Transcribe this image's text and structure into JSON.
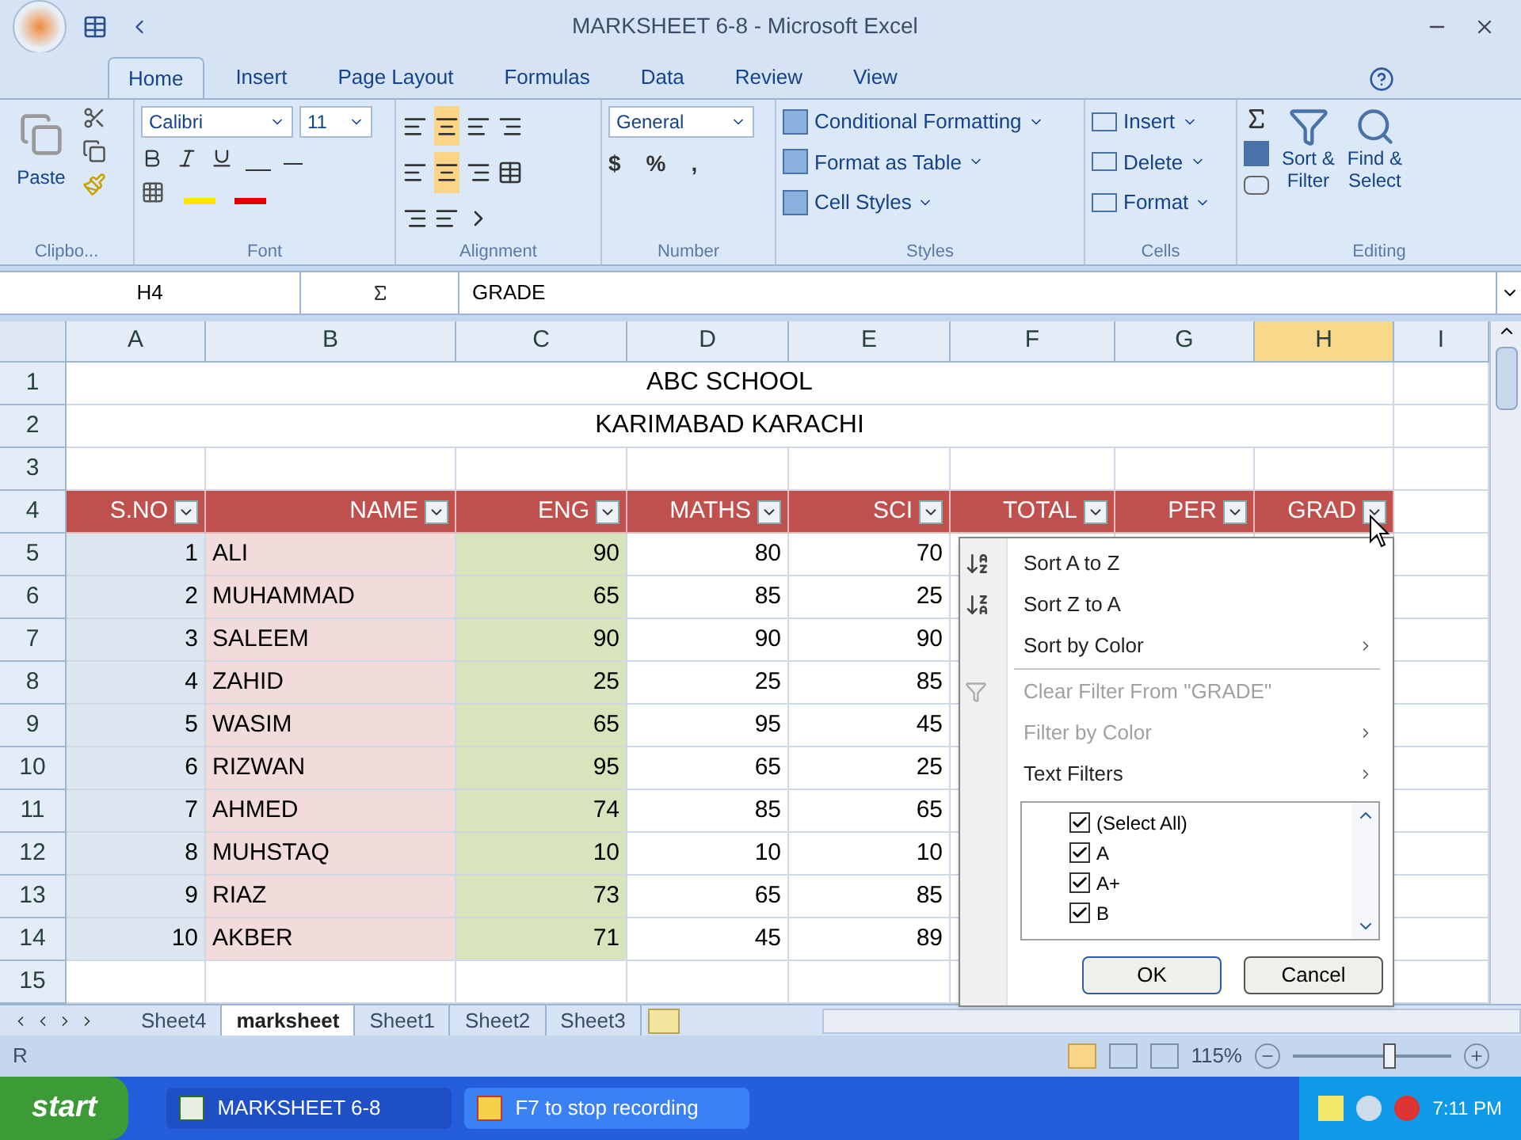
{
  "window": {
    "title": "MARKSHEET 6-8 - Microsoft Excel"
  },
  "ribbon_tabs": [
    {
      "label": "Home",
      "selected": true
    },
    {
      "label": "Insert",
      "selected": false
    },
    {
      "label": "Page Layout",
      "selected": false
    },
    {
      "label": "Formulas",
      "selected": false
    },
    {
      "label": "Data",
      "selected": false
    },
    {
      "label": "Review",
      "selected": false
    },
    {
      "label": "View",
      "selected": false
    }
  ],
  "ribbon": {
    "clipboard": {
      "paste": "Paste",
      "label": "Clipbo..."
    },
    "font": {
      "name": "Calibri",
      "size": "11",
      "label": "Font"
    },
    "alignment": {
      "label": "Alignment"
    },
    "number": {
      "format": "General",
      "currency": "$",
      "percent": "%",
      "comma": ",",
      "label": "Number"
    },
    "styles": {
      "items": [
        "Conditional Formatting",
        "Format as Table",
        "Cell Styles"
      ],
      "label": "Styles"
    },
    "cells": {
      "items": [
        "Insert",
        "Delete",
        "Format"
      ],
      "label": "Cells"
    },
    "editing": {
      "sort": [
        "Sort &",
        "Filter"
      ],
      "find": [
        "Find &",
        "Select"
      ],
      "label": "Editing"
    }
  },
  "formula_bar": {
    "name_box": "H4",
    "formula": "GRADE"
  },
  "columns": [
    {
      "label": "A",
      "selected": false
    },
    {
      "label": "B",
      "selected": false
    },
    {
      "label": "C",
      "selected": false
    },
    {
      "label": "D",
      "selected": false
    },
    {
      "label": "E",
      "selected": false
    },
    {
      "label": "F",
      "selected": false
    },
    {
      "label": "G",
      "selected": false
    },
    {
      "label": "H",
      "selected": true
    },
    {
      "label": "I",
      "selected": false
    }
  ],
  "title_rows": [
    {
      "row": "1",
      "text": "ABC SCHOOL"
    },
    {
      "row": "2",
      "text": "KARIMABAD KARACHI"
    }
  ],
  "blank_row_before": {
    "row": "3"
  },
  "header_row": {
    "row": "4",
    "headers": [
      "S.NO",
      "NAME",
      "ENG",
      "MATHS",
      "SCI",
      "TOTAL",
      "PER",
      "GRAD"
    ]
  },
  "data_rows": [
    {
      "row": "5",
      "sno": "1",
      "name": "ALI",
      "eng": "90",
      "maths": "80",
      "sci": "70"
    },
    {
      "row": "6",
      "sno": "2",
      "name": "MUHAMMAD",
      "eng": "65",
      "maths": "85",
      "sci": "25"
    },
    {
      "row": "7",
      "sno": "3",
      "name": "SALEEM",
      "eng": "90",
      "maths": "90",
      "sci": "90"
    },
    {
      "row": "8",
      "sno": "4",
      "name": "ZAHID",
      "eng": "25",
      "maths": "25",
      "sci": "85"
    },
    {
      "row": "9",
      "sno": "5",
      "name": "WASIM",
      "eng": "65",
      "maths": "95",
      "sci": "45"
    },
    {
      "row": "10",
      "sno": "6",
      "name": "RIZWAN",
      "eng": "95",
      "maths": "65",
      "sci": "25"
    },
    {
      "row": "11",
      "sno": "7",
      "name": "AHMED",
      "eng": "74",
      "maths": "85",
      "sci": "65"
    },
    {
      "row": "12",
      "sno": "8",
      "name": "MUHSTAQ",
      "eng": "10",
      "maths": "10",
      "sci": "10"
    },
    {
      "row": "13",
      "sno": "9",
      "name": "RIAZ",
      "eng": "73",
      "maths": "65",
      "sci": "85"
    },
    {
      "row": "14",
      "sno": "10",
      "name": "AKBER",
      "eng": "71",
      "maths": "45",
      "sci": "89"
    }
  ],
  "blank_row_after": {
    "row": "15"
  },
  "filter_menu": {
    "items": [
      {
        "kind": "sort-asc",
        "label": "Sort A to Z",
        "disabled": false,
        "submenu": false
      },
      {
        "kind": "sort-desc",
        "label": "Sort Z to A",
        "disabled": false,
        "submenu": false
      },
      {
        "kind": "plain",
        "label": "Sort by Color",
        "disabled": false,
        "submenu": true
      },
      {
        "kind": "clear",
        "label": "Clear Filter From \"GRADE\"",
        "disabled": true,
        "submenu": false
      },
      {
        "kind": "plain",
        "label": "Filter by Color",
        "disabled": true,
        "submenu": true
      },
      {
        "kind": "plain",
        "label": "Text Filters",
        "disabled": false,
        "submenu": true
      }
    ],
    "values": [
      {
        "label": "(Select All)",
        "checked": true
      },
      {
        "label": "A",
        "checked": true
      },
      {
        "label": "A+",
        "checked": true
      },
      {
        "label": "B",
        "checked": true
      }
    ],
    "buttons": [
      "OK",
      "Cancel"
    ]
  },
  "sheet_tabs": [
    {
      "label": "Sheet4",
      "selected": false
    },
    {
      "label": "marksheet",
      "selected": true
    },
    {
      "label": "Sheet1",
      "selected": false
    },
    {
      "label": "Sheet2",
      "selected": false
    },
    {
      "label": "Sheet3",
      "selected": false
    }
  ],
  "status_bar": {
    "text": "R",
    "zoom": "115%",
    "zoom_slider": {
      "level": 0.62
    }
  },
  "taskbar": {
    "start": "start",
    "tasks": [
      {
        "label": "MARKSHEET 6-8",
        "kind": "excel"
      },
      {
        "label": "F7 to stop recording",
        "kind": "recorder"
      }
    ],
    "clock": "7:11 PM"
  }
}
